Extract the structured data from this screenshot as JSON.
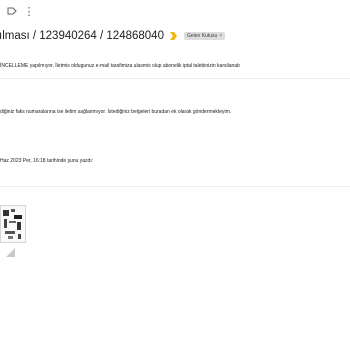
{
  "toolbar": {
    "icons": [
      "label-icon",
      "more-vert-icon"
    ],
    "more_glyph": "⋮"
  },
  "email": {
    "subject": "ılması / 123940264 / 124868040",
    "label": "Gelen Kutusu",
    "label_remove": "×",
    "line1": "İNCELLEME yapılmıyor. İletmis oldugunuz e-mail tarafimiza ulasmis olup abonelik iptal talebinizin karsilanab",
    "line2": "diğiniz faks numaralarına ise iletim sağlanmıyor. İstediğiniz belgeleri buradan ek olarak göndermekteyim.",
    "quote_header": "Haz 2023 Per, 16:18 tarihinde şunu yazdı:"
  },
  "colors": {
    "importance": "#f4b400",
    "label_bg": "#dddddd",
    "divider": "#ececec"
  }
}
